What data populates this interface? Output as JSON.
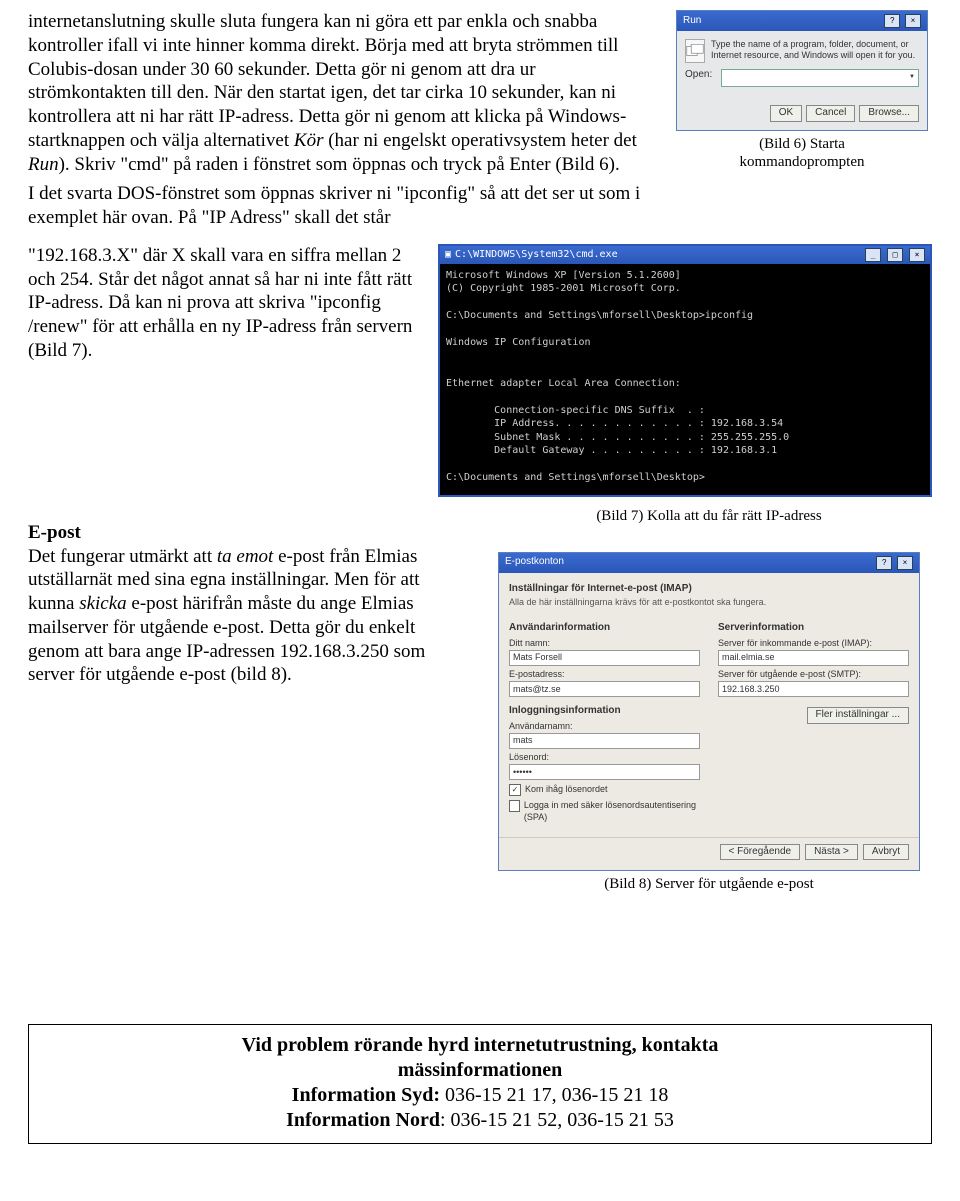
{
  "para1": {
    "p1a": "internetanslutning skulle sluta fungera kan ni göra ett par enkla och snabba kontroller ifall vi inte hinner komma direkt. Börja med att bryta strömmen till Colubis-dosan under 30 60 sekunder. Detta gör ni genom att dra ur strömkontakten till den. När den startat igen, det tar cirka 10 sekunder, kan ni kontrollera att ni har rätt IP-adress. Detta gör ni genom att klicka på Windows-startknappen och välja alternativet ",
    "p1kor": "Kör",
    "p1b": " (har ni engelskt operativsystem heter det ",
    "p1run": "Run",
    "p1c": "). Skriv \"cmd\" på raden i fönstret som öppnas och tryck på Enter (Bild 6).",
    "p2": "I det svarta DOS-fönstret som öppnas skriver ni \"ipconfig\" så att det ser ut som i exemplet här ovan. På \"IP Adress\" skall det står"
  },
  "run_dialog": {
    "title": "Run",
    "desc": "Type the name of a program, folder, document, or Internet resource, and Windows will open it for you.",
    "open_label": "Open:",
    "ok": "OK",
    "cancel": "Cancel",
    "browse": "Browse..."
  },
  "caption6_a": "(Bild 6) Starta",
  "caption6_b": "kommandoprompten",
  "para2": "\"192.168.3.X\" där X skall vara en siffra mellan 2 och 254. Står det något annat så har ni inte fått rätt IP-adress. Då kan ni prova att skriva \"ipconfig /renew\" för att erhålla en ny IP-adress från servern (Bild 7).",
  "cmd": {
    "title": "C:\\WINDOWS\\System32\\cmd.exe",
    "body": "Microsoft Windows XP [Version 5.1.2600]\n(C) Copyright 1985-2001 Microsoft Corp.\n\nC:\\Documents and Settings\\mforsell\\Desktop>ipconfig\n\nWindows IP Configuration\n\n\nEthernet adapter Local Area Connection:\n\n        Connection-specific DNS Suffix  . :\n        IP Address. . . . . . . . . . . . : 192.168.3.54\n        Subnet Mask . . . . . . . . . . . : 255.255.255.0\n        Default Gateway . . . . . . . . . : 192.168.3.1\n\nC:\\Documents and Settings\\mforsell\\Desktop>"
  },
  "caption7": "(Bild 7) Kolla att du får rätt IP-adress",
  "epost_title": "E-post",
  "para3a": "Det fungerar utmärkt att ",
  "para3a_it": "ta emot",
  "para3b": " e-post från Elmias utställarnät med sina egna inställningar. Men för att kunna ",
  "para3b_it": "skicka",
  "para3c": " e-post härifrån måste du ange Elmias mailserver för utgående e-post. Detta gör du enkelt genom att bara ange IP-adressen 192.168.3.250 som server för utgående e-post (bild 8).",
  "email_dialog": {
    "title": "E-postkonton",
    "heading": "Inställningar för Internet-e-post (IMAP)",
    "sub": "Alla de här inställningarna krävs för att e-postkontot ska fungera.",
    "user_section": "Användarinformation",
    "name_label": "Ditt namn:",
    "name_value": "Mats Forsell",
    "email_label": "E-postadress:",
    "email_value": "mats@tz.se",
    "server_section": "Serverinformation",
    "incoming_label": "Server för inkommande e-post (IMAP):",
    "incoming_value": "mail.elmia.se",
    "outgoing_label": "Server för utgående e-post (SMTP):",
    "outgoing_value": "192.168.3.250",
    "login_section": "Inloggningsinformation",
    "user_label": "Användarnamn:",
    "user_value": "mats",
    "pass_label": "Lösenord:",
    "pass_value": "••••••",
    "remember": "Kom ihåg lösenordet",
    "spa": "Logga in med säker lösenordsautentisering (SPA)",
    "more": "Fler inställningar ...",
    "back": "< Föregående",
    "next": "Nästa >",
    "cancel": "Avbryt"
  },
  "caption8": "(Bild 8) Server för utgående e-post",
  "contact": {
    "line1": "Vid problem rörande hyrd internetutrustning, kontakta",
    "line2": "mässinformationen",
    "line3a": "Information Syd:",
    "line3b": " 036-15 21 17, 036-15 21 18",
    "line4a": "Information Nord",
    "line4b": ": 036-15 21 52, 036-15 21 53"
  }
}
